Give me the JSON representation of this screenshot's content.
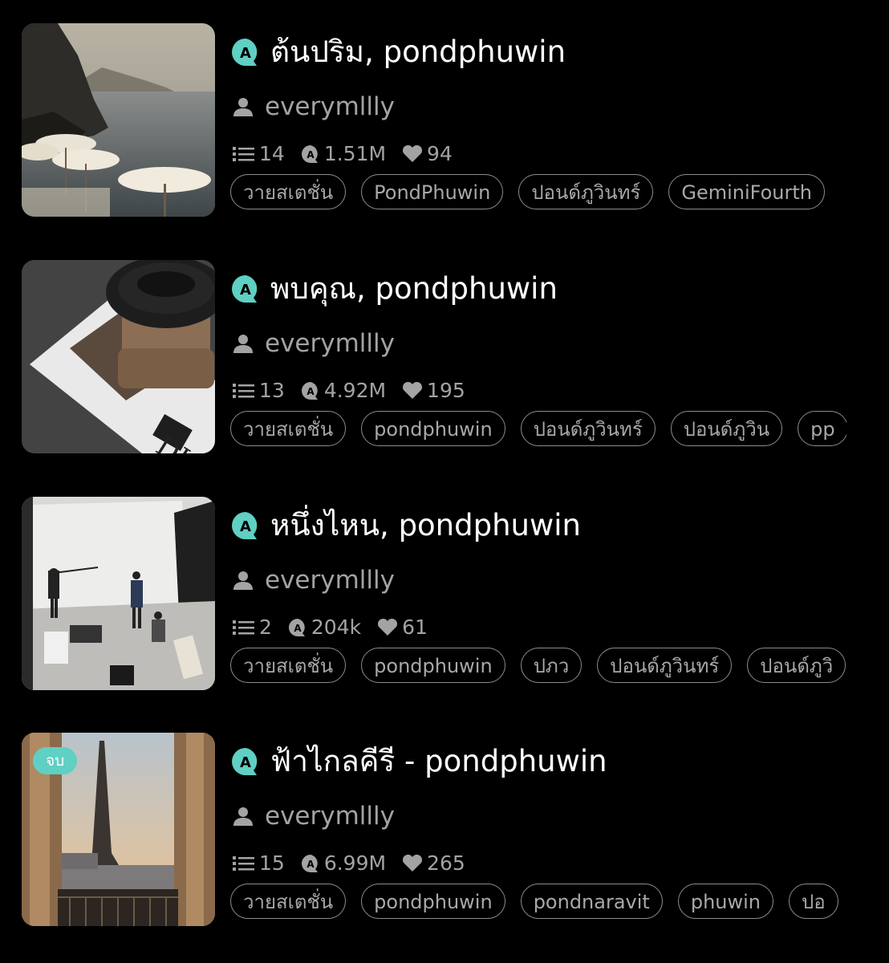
{
  "stories": [
    {
      "title": "ต้นปริม, pondphuwin",
      "author": "everymllly",
      "chapters": "14",
      "reads": "1.51M",
      "likes": "94",
      "status": "",
      "cover_icon": "beach-umbrellas-image",
      "tags": [
        "วายสเตชั่น",
        "PondPhuwin",
        "ปอนด์ภูวินทร์",
        "GeminiFourth"
      ]
    },
    {
      "title": "พบคุณ, pondphuwin",
      "author": "everymllly",
      "chapters": "13",
      "reads": "4.92M",
      "likes": "195",
      "status": "",
      "cover_icon": "coffee-cup-image",
      "tags": [
        "วายสเตชั่น",
        "pondphuwin",
        "ปอนด์ภูวินทร์",
        "ปอนด์ภูวิน",
        "pp"
      ]
    },
    {
      "title": "หนึ่งไหน, pondphuwin",
      "author": "everymllly",
      "chapters": "2",
      "reads": "204k",
      "likes": "61",
      "status": "",
      "cover_icon": "photo-studio-image",
      "tags": [
        "วายสเตชั่น",
        "pondphuwin",
        "ปภว",
        "ปอนด์ภูวินทร์",
        "ปอนด์ภูวิ"
      ]
    },
    {
      "title": "ฟ้าไกลคีรี - pondphuwin",
      "author": "everymllly",
      "chapters": "15",
      "reads": "6.99M",
      "likes": "265",
      "status": "จบ",
      "cover_icon": "eiffel-tower-image",
      "tags": [
        "วายสเตชั่น",
        "pondphuwin",
        "pondnaravit",
        "phuwin",
        "ปอ"
      ]
    }
  ],
  "colors": {
    "background": "#000000",
    "accent": "#5fd0c3",
    "muted_text": "#a3a3a3",
    "tag_border": "#8c8c8c"
  },
  "icons": {
    "app_badge": "speech-bubble-a-icon",
    "author": "user-icon",
    "chapters": "list-icon",
    "reads": "reads-bubble-icon",
    "likes": "heart-icon"
  }
}
